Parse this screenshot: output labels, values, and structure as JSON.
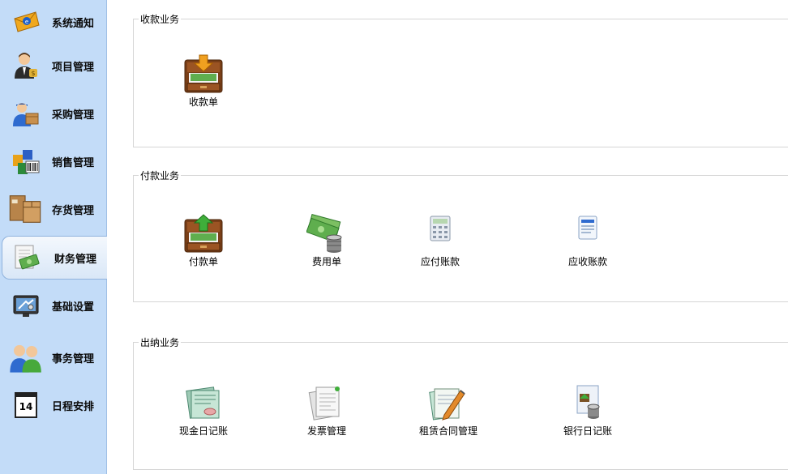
{
  "sidebar": {
    "items": [
      {
        "label": "系统通知",
        "icon": "envelope-icon"
      },
      {
        "label": "项目管理",
        "icon": "manager-person-icon"
      },
      {
        "label": "采购管理",
        "icon": "delivery-person-icon"
      },
      {
        "label": "销售管理",
        "icon": "barcode-boxes-icon"
      },
      {
        "label": "存货管理",
        "icon": "cardboard-boxes-icon"
      },
      {
        "label": "财务管理",
        "icon": "money-document-icon"
      },
      {
        "label": "基础设置",
        "icon": "monitor-tools-icon"
      },
      {
        "label": "事务管理",
        "icon": "people-icon"
      },
      {
        "label": "日程安排",
        "icon": "calendar-icon"
      }
    ],
    "active_index": 5,
    "calendar_day": "14"
  },
  "sections": {
    "receipt": {
      "title": "收款业务",
      "items": [
        {
          "label": "收款单",
          "icon": "cash-drawer-in-icon"
        }
      ]
    },
    "payment": {
      "title": "付款业务",
      "items": [
        {
          "label": "付款单",
          "icon": "cash-drawer-out-icon"
        },
        {
          "label": "费用单",
          "icon": "cash-coins-icon"
        },
        {
          "label": "应付账款",
          "icon": "calculator-icon"
        },
        {
          "label": "应收账款",
          "icon": "form-document-icon"
        }
      ]
    },
    "cashier": {
      "title": "出纳业务",
      "items": [
        {
          "label": "现金日记账",
          "icon": "cash-journal-icon"
        },
        {
          "label": "发票管理",
          "icon": "invoice-stack-icon"
        },
        {
          "label": "租赁合同管理",
          "icon": "contract-pen-icon"
        },
        {
          "label": "银行日记账",
          "icon": "bank-journal-icon"
        }
      ]
    }
  },
  "colors": {
    "sidebar_bg": "#c3dcf8",
    "panel_border": "#d6d6d6"
  }
}
